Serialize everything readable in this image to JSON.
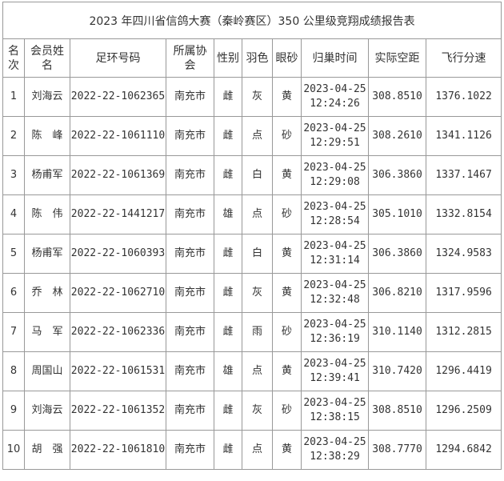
{
  "title": "2023 年四川省信鸽大赛（秦岭赛区）350 公里级竞翔成绩报告表",
  "headers": {
    "rank": [
      "名",
      "次"
    ],
    "name": [
      "会员姓",
      "名"
    ],
    "ring": "足环号码",
    "assoc": [
      "所属协",
      "会"
    ],
    "sex": "性别",
    "color": "羽色",
    "eye": "眼砂",
    "return_time": "归巢时间",
    "distance": "实际空距",
    "speed": "飞行分速"
  },
  "rows": [
    {
      "rank": "1",
      "name": "刘海云",
      "ring": "2022-22-1062365",
      "assoc": "南充市",
      "sex": "雌",
      "color": "灰",
      "eye": "黄",
      "date": "2023-04-25",
      "time": "12:24:26",
      "distance": "308.8510",
      "speed": "1376.1022"
    },
    {
      "rank": "2",
      "name": "陈　峰",
      "ring": "2022-22-1061110",
      "assoc": "南充市",
      "sex": "雌",
      "color": "点",
      "eye": "砂",
      "date": "2023-04-25",
      "time": "12:29:51",
      "distance": "308.2610",
      "speed": "1341.1126"
    },
    {
      "rank": "3",
      "name": "杨甫军",
      "ring": "2022-22-1061369",
      "assoc": "南充市",
      "sex": "雌",
      "color": "白",
      "eye": "黄",
      "date": "2023-04-25",
      "time": "12:29:08",
      "distance": "306.3860",
      "speed": "1337.1467"
    },
    {
      "rank": "4",
      "name": "陈　伟",
      "ring": "2022-22-1441217",
      "assoc": "南充市",
      "sex": "雄",
      "color": "点",
      "eye": "砂",
      "date": "2023-04-25",
      "time": "12:28:54",
      "distance": "305.1010",
      "speed": "1332.8154"
    },
    {
      "rank": "5",
      "name": "杨甫军",
      "ring": "2022-22-1060393",
      "assoc": "南充市",
      "sex": "雌",
      "color": "白",
      "eye": "黄",
      "date": "2023-04-25",
      "time": "12:31:14",
      "distance": "306.3860",
      "speed": "1324.9583"
    },
    {
      "rank": "6",
      "name": "乔　林",
      "ring": "2022-22-1062710",
      "assoc": "南充市",
      "sex": "雌",
      "color": "灰",
      "eye": "黄",
      "date": "2023-04-25",
      "time": "12:32:48",
      "distance": "306.8210",
      "speed": "1317.9596"
    },
    {
      "rank": "7",
      "name": "马　军",
      "ring": "2022-22-1062336",
      "assoc": "南充市",
      "sex": "雌",
      "color": "雨",
      "eye": "砂",
      "date": "2023-04-25",
      "time": "12:36:19",
      "distance": "310.1140",
      "speed": "1312.2815"
    },
    {
      "rank": "8",
      "name": "周国山",
      "ring": "2022-22-1061531",
      "assoc": "南充市",
      "sex": "雄",
      "color": "点",
      "eye": "黄",
      "date": "2023-04-25",
      "time": "12:39:41",
      "distance": "310.7420",
      "speed": "1296.4419"
    },
    {
      "rank": "9",
      "name": "刘海云",
      "ring": "2022-22-1061352",
      "assoc": "南充市",
      "sex": "雌",
      "color": "灰",
      "eye": "砂",
      "date": "2023-04-25",
      "time": "12:38:15",
      "distance": "308.8510",
      "speed": "1296.2509"
    },
    {
      "rank": "10",
      "name": "胡　强",
      "ring": "2022-22-1061810",
      "assoc": "南充市",
      "sex": "雌",
      "color": "点",
      "eye": "黄",
      "date": "2023-04-25",
      "time": "12:38:29",
      "distance": "308.7770",
      "speed": "1294.6842"
    }
  ]
}
